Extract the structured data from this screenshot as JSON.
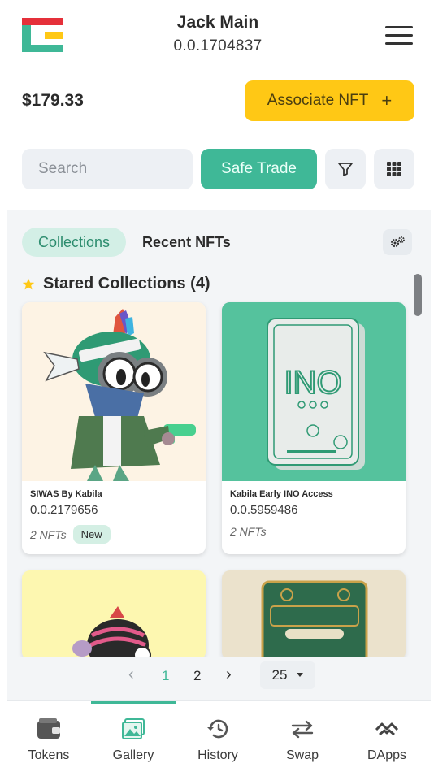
{
  "account": {
    "name": "Jack Main",
    "id": "0.0.1704837"
  },
  "balance": "$179.33",
  "associate": {
    "label": "Associate NFT",
    "icon": "+"
  },
  "search": {
    "placeholder": "Search"
  },
  "safe_trade": {
    "label": "Safe Trade"
  },
  "tabs": {
    "active": "Collections",
    "other": "Recent NFTs"
  },
  "section": {
    "title": "Stared Collections (4)"
  },
  "collections": [
    {
      "name": "SIWAS By Kabila",
      "id": "0.0.2179656",
      "count": "2 NFTs",
      "badge": "New"
    },
    {
      "name": "Kabila Early INO Access",
      "id": "0.0.5959486",
      "count": "2 NFTs"
    }
  ],
  "pagination": {
    "prev": "‹",
    "pages": [
      "1",
      "2"
    ],
    "current": "1",
    "next": "›",
    "per_page": "25"
  },
  "nav": [
    {
      "label": "Tokens",
      "icon": "wallet-icon"
    },
    {
      "label": "Gallery",
      "icon": "image-icon",
      "active": true
    },
    {
      "label": "History",
      "icon": "history-icon"
    },
    {
      "label": "Swap",
      "icon": "swap-icon"
    },
    {
      "label": "DApps",
      "icon": "dapps-icon"
    }
  ],
  "colors": {
    "accent": "#3fb897",
    "yellow": "#ffc815",
    "red": "#e5303a"
  }
}
